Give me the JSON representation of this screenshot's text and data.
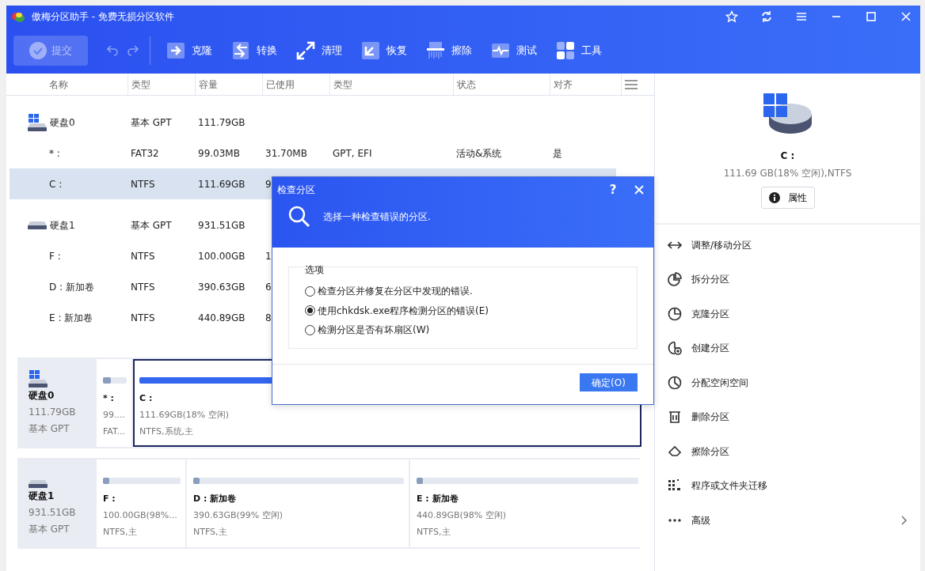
{
  "window": {
    "title": "傲梅分区助手 - 免费无损分区软件"
  },
  "toolbar": {
    "submit": {
      "label": "提交",
      "disabled": true
    },
    "history": [
      {
        "kind": "undo",
        "disabled": true
      },
      {
        "kind": "redo",
        "disabled": true
      }
    ],
    "tools": [
      {
        "kind": "clone",
        "label": "克隆"
      },
      {
        "kind": "convert",
        "label": "转换"
      },
      {
        "kind": "clean",
        "label": "清理"
      },
      {
        "kind": "restore",
        "label": "恢复"
      },
      {
        "kind": "wipe",
        "label": "擦除"
      },
      {
        "kind": "test",
        "label": "测试"
      },
      {
        "kind": "tools",
        "label": "工具"
      }
    ]
  },
  "table": {
    "columns": [
      "名称",
      "类型",
      "容量",
      "已使用",
      "类型",
      "状态",
      "对齐"
    ],
    "rows": [
      {
        "kind": "system_disk",
        "selected": false,
        "cells": [
          "硬盘0",
          "基本 GPT",
          "111.79GB"
        ]
      },
      {
        "kind": "partition",
        "selected": false,
        "cells": [
          "* :",
          "FAT32",
          "99.03MB",
          "31.70MB",
          "GPT, EFI",
          "活动&系统",
          "是"
        ]
      },
      {
        "kind": "partition",
        "selected": true,
        "cells": [
          "C :",
          "NTFS",
          "111.69GB",
          "9"
        ]
      },
      {
        "kind": "disk",
        "selected": false,
        "cells": [
          "硬盘1",
          "基本 GPT",
          "931.51GB"
        ]
      },
      {
        "kind": "partition",
        "selected": false,
        "cells": [
          "F :",
          "NTFS",
          "100.00GB",
          "1"
        ]
      },
      {
        "kind": "partition",
        "selected": false,
        "cells": [
          "D : 新加卷",
          "NTFS",
          "390.63GB",
          "6"
        ]
      },
      {
        "kind": "partition",
        "selected": false,
        "cells": [
          "E : 新加卷",
          "NTFS",
          "440.89GB",
          "8"
        ]
      }
    ]
  },
  "disk_map": [
    {
      "kind": "system_disk",
      "name": "硬盘0",
      "size": "111.79GB",
      "type": "基本 GPT",
      "partitions": [
        {
          "label": "* :",
          "size": "99....",
          "info": "FAT...",
          "level": 0.32,
          "selected": false
        },
        {
          "label": "C :",
          "size": "111.69GB(18% 空闲)",
          "info": "NTFS,系统,主",
          "level": 0.82,
          "selected": true
        }
      ]
    },
    {
      "kind": "disk",
      "name": "硬盘1",
      "size": "931.51GB",
      "type": "基本 GPT",
      "partitions": [
        {
          "label": "F :",
          "size": "100.00GB(98%...",
          "info": "NTFS,主",
          "level": 0.02,
          "selected": false
        },
        {
          "label": "D : 新加卷",
          "size": "390.63GB(99% 空闲)",
          "info": "NTFS,主",
          "level": 0.01,
          "selected": false
        },
        {
          "label": "E : 新加卷",
          "size": "440.89GB(98% 空闲)",
          "info": "NTFS,主",
          "level": 0.02,
          "selected": false
        }
      ]
    }
  ],
  "details": {
    "drive": "C :",
    "info": "111.69 GB(18% 空闲),NTFS",
    "properties": "属性"
  },
  "actions": [
    {
      "kind": "resize",
      "label": "调整/移动分区"
    },
    {
      "kind": "split",
      "label": "拆分分区"
    },
    {
      "kind": "clone",
      "label": "克隆分区"
    },
    {
      "kind": "create",
      "label": "创建分区"
    },
    {
      "kind": "allocate",
      "label": "分配空闲空间"
    },
    {
      "kind": "delete",
      "label": "删除分区"
    },
    {
      "kind": "wipe",
      "label": "擦除分区"
    },
    {
      "kind": "migrate",
      "label": "程序或文件夹迁移"
    },
    {
      "kind": "more",
      "label": "高级",
      "submenu": true
    }
  ],
  "dialog": {
    "title": "检查分区",
    "help": "?",
    "header": "选择一种检查错误的分区.",
    "group": "选项",
    "options": [
      {
        "label": "检查分区并修复在分区中发现的错误.",
        "selected": false
      },
      {
        "label": "使用chkdsk.exe程序检测分区的错误(E)",
        "selected": true
      },
      {
        "label": "检测分区是否有坏扇区(W)",
        "selected": false
      }
    ],
    "ok": "确定(O)"
  }
}
